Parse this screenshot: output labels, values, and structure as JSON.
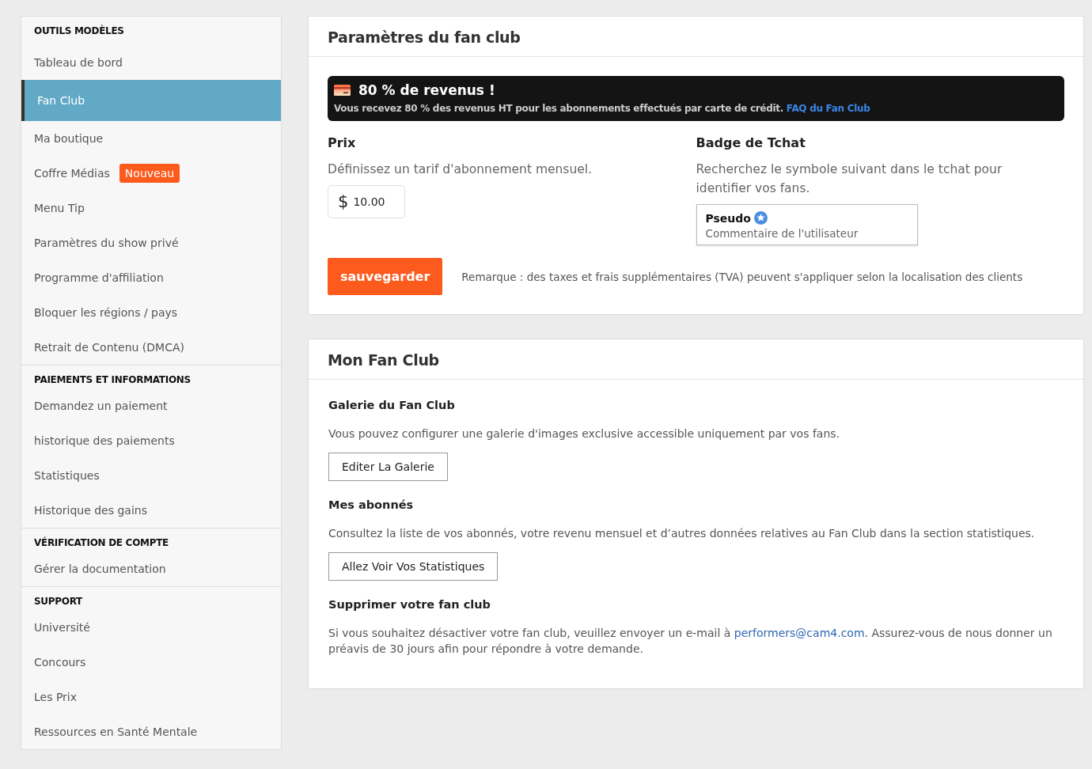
{
  "sidebar": {
    "sections": [
      {
        "title": "OUTILS MODÈLES",
        "items": [
          {
            "label": "Tableau de bord",
            "selected": false
          },
          {
            "label": "Fan Club",
            "selected": true
          },
          {
            "label": "Ma boutique",
            "selected": false
          },
          {
            "label": "Coffre Médias",
            "selected": false,
            "badge": "Nouveau"
          },
          {
            "label": "Menu Tip",
            "selected": false
          },
          {
            "label": "Paramètres du show privé",
            "selected": false
          },
          {
            "label": "Programme d'affiliation",
            "selected": false
          },
          {
            "label": "Bloquer les régions / pays",
            "selected": false
          },
          {
            "label": "Retrait de Contenu (DMCA)",
            "selected": false
          }
        ]
      },
      {
        "title": "PAIEMENTS ET INFORMATIONS",
        "items": [
          {
            "label": "Demandez un paiement",
            "selected": false
          },
          {
            "label": "historique des paiements",
            "selected": false
          },
          {
            "label": "Statistiques",
            "selected": false
          },
          {
            "label": "Historique des gains",
            "selected": false
          }
        ]
      },
      {
        "title": "VÉRIFICATION DE COMPTE",
        "items": [
          {
            "label": "Gérer la documentation",
            "selected": false
          }
        ]
      },
      {
        "title": "SUPPORT",
        "items": [
          {
            "label": "Université",
            "selected": false
          },
          {
            "label": "Concours",
            "selected": false
          },
          {
            "label": "Les Prix",
            "selected": false
          },
          {
            "label": "Ressources en Santé Mentale",
            "selected": false
          }
        ]
      }
    ]
  },
  "settings": {
    "title": "Paramètres du fan club",
    "banner": {
      "title": "80 % de revenus !",
      "text": "Vous recevez 80 % des revenus HT pour les abonnements effectués par carte de crédit.",
      "link": "FAQ du Fan Club"
    },
    "price": {
      "title": "Prix",
      "description": "Définissez un tarif d'abonnement mensuel.",
      "currency": "$",
      "value": "10.00"
    },
    "badge": {
      "title": "Badge de Tchat",
      "description": "Recherchez le symbole suivant dans le tchat pour identifier vos fans.",
      "username": "Pseudo",
      "comment": "Commentaire de l'utilisateur"
    },
    "save_button": "sauvegarder",
    "note": "Remarque : des taxes et frais supplémentaires (TVA) peuvent s'appliquer selon la localisation des clients"
  },
  "fan_club": {
    "title": "Mon Fan Club",
    "sections": [
      {
        "title": "Galerie du Fan Club",
        "text": "Vous pouvez configurer une galerie d'images exclusive accessible uniquement par vos fans.",
        "button": "Editer La Galerie"
      },
      {
        "title": "Mes abonnés",
        "text": "Consultez la liste de vos abonnés, votre revenu mensuel et d’autres données relatives au Fan Club dans la section statistiques.",
        "button": "Allez Voir Vos Statistiques"
      },
      {
        "title": "Supprimer votre fan club",
        "text_before": "Si vous souhaitez désactiver votre fan club, veuillez envoyer un e-mail à ",
        "email": "performers@cam4.com",
        "text_after": ". Assurez-vous de nous donner un préavis de 30 jours afin pour répondre à votre demande."
      }
    ]
  }
}
